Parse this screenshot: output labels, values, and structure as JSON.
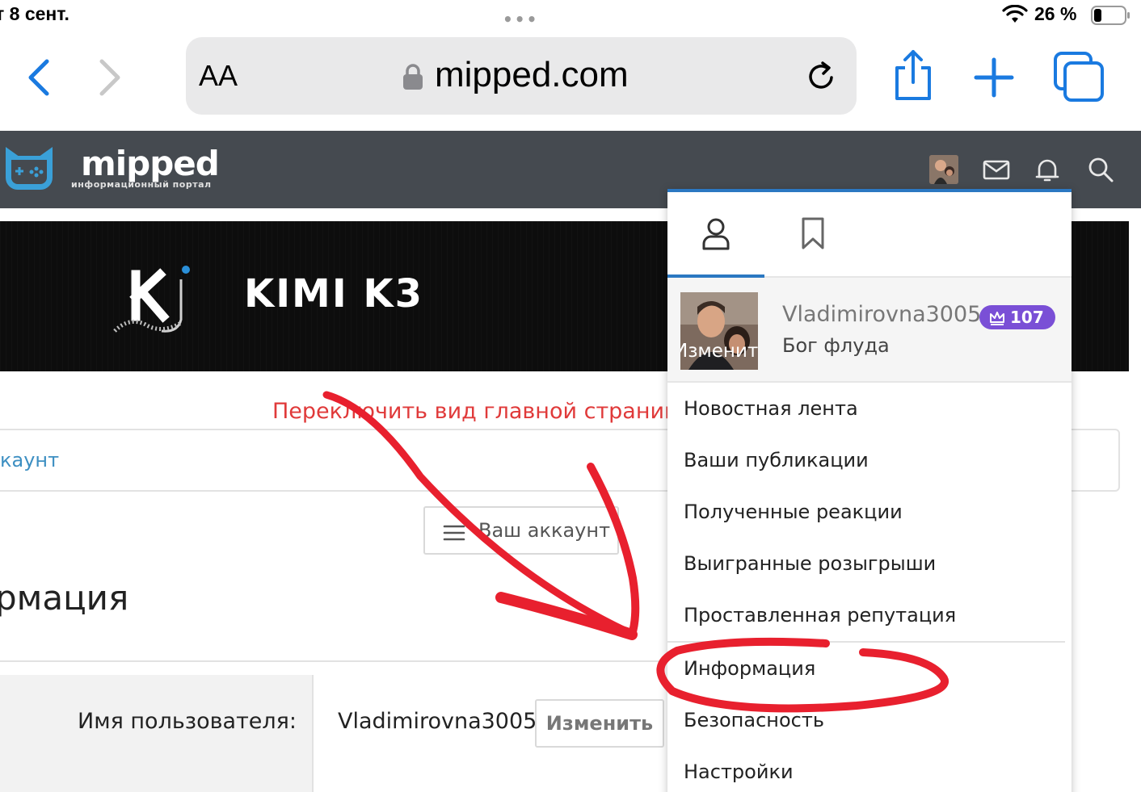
{
  "status_bar": {
    "time": "т 8 сент.",
    "battery_percent": "26 %",
    "battery_level": 0.26
  },
  "browser": {
    "text_size_label": "AA",
    "url": "mipped.com"
  },
  "site": {
    "logo_text": "mipped",
    "logo_subtitle": "информационный портал"
  },
  "banner": {
    "title": "KIMI K3"
  },
  "content": {
    "switch_view_link": "Переключить вид главной страницы",
    "account_breadcrumb": "каунт",
    "account_menu_label": "Ваш аккаунт",
    "page_title": "рмация",
    "username_label": "Имя пользователя:",
    "username_value": "Vladimirovna3005",
    "edit_button": "Изменить"
  },
  "dropdown": {
    "username": "Vladimirovna3005",
    "badge_count": "107",
    "rank": "Бог флуда",
    "avatar_edit": "Изменить",
    "items": [
      "Новостная лента",
      "Ваши публикации",
      "Полученные реакции",
      "Выигранные розыгрыши",
      "Проставленная репутация",
      "Информация",
      "Безопасность",
      "Настройки"
    ]
  },
  "colors": {
    "header_bg": "#454a50",
    "accent_blue": "#2b78c2",
    "ios_blue": "#1a7ae0",
    "badge_purple": "#7a4fd6",
    "link_red": "#e03a3a",
    "annotation_red": "#e8202e"
  }
}
